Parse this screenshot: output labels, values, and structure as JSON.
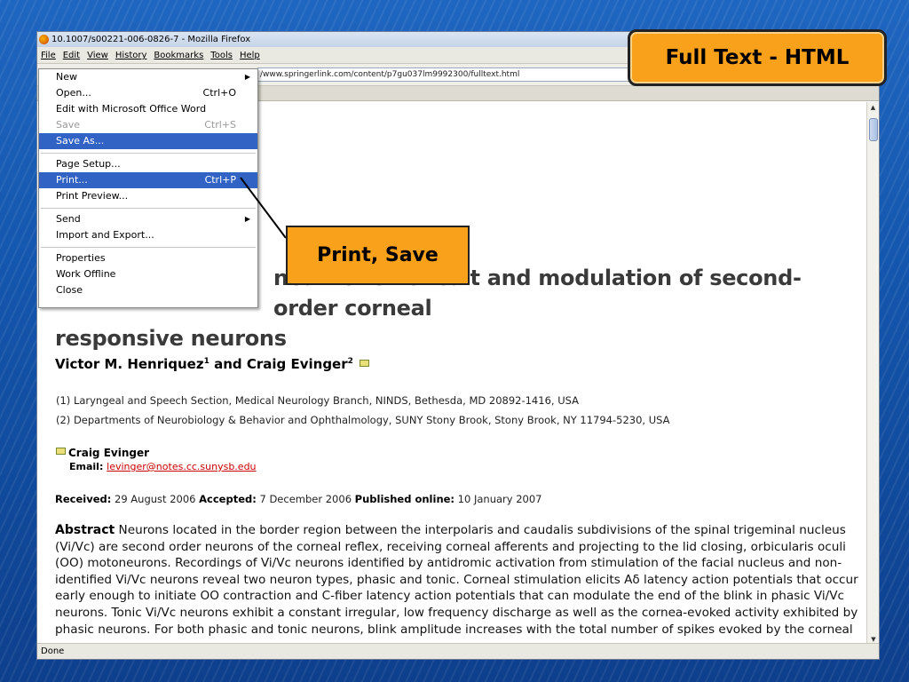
{
  "window": {
    "title": "10.1007/s00221-006-0826-7 - Mozilla Firefox",
    "menu": [
      "File",
      "Edit",
      "View",
      "History",
      "Bookmarks",
      "Tools",
      "Help"
    ],
    "url": "/www.springerlink.com/content/p7gu037lm9992300/fulltext.html",
    "status": "Done"
  },
  "file_menu": {
    "items": [
      {
        "label": "New",
        "shortcut": "",
        "submenu": true
      },
      {
        "label": "Open...",
        "shortcut": "Ctrl+O"
      },
      {
        "label": "Edit with Microsoft Office Word",
        "shortcut": ""
      },
      {
        "label": "Save",
        "shortcut": "Ctrl+S",
        "disabled": true
      },
      {
        "label": "Save As...",
        "shortcut": "",
        "selected": true
      },
      {
        "label": "Page Setup...",
        "shortcut": ""
      },
      {
        "label": "Print...",
        "shortcut": "Ctrl+P",
        "selected": true
      },
      {
        "label": "Print Preview...",
        "shortcut": ""
      },
      {
        "label": "Send",
        "shortcut": "",
        "submenu": true
      },
      {
        "label": "Import and Export...",
        "shortcut": ""
      },
      {
        "label": "Properties",
        "shortcut": ""
      },
      {
        "label": "Work Offline",
        "shortcut": ""
      },
      {
        "label": "Close",
        "shortcut": ""
      }
    ]
  },
  "article": {
    "title_line1": "neal reflex circuit and modulation of second-order corneal",
    "title_line2": "responsive neurons",
    "author1": "Victor M. Henriquez",
    "author1_sup": "1",
    "and": " and ",
    "author2": "Craig Evinger",
    "author2_sup": "2",
    "affiliation1": "(1)  Laryngeal and Speech Section, Medical Neurology Branch, NINDS, Bethesda, MD 20892-1416, USA",
    "affiliation2": "(2)  Departments of Neurobiology & Behavior and Ophthalmology, SUNY Stony Brook, Stony Brook, NY 11794-5230, USA",
    "corr_name": "Craig Evinger",
    "email_label": "Email: ",
    "email": "levinger@notes.cc.sunysb.edu",
    "received_label": "Received:",
    "received": " 29 August 2006  ",
    "accepted_label": "Accepted:",
    "accepted": " 7 December 2006  ",
    "published_label": "Published online:",
    "published": " 10 January 2007",
    "abstract_label": "Abstract",
    "abstract_text": "  Neurons located in the border region between the interpolaris and caudalis subdivisions of the spinal trigeminal nucleus (Vi/Vc) are second order neurons of the corneal reflex, receiving corneal afferents and projecting to the lid closing, orbicularis oculi (OO) motoneurons. Recordings of Vi/Vc neurons identified by antidromic activation from stimulation of the facial nucleus and non-identified Vi/Vc neurons reveal two neuron types, phasic and tonic. Corneal stimulation elicits Aδ latency action potentials that occur early enough to initiate OO contraction and C-fiber latency action potentials that can modulate the end of the blink in phasic Vi/Vc neurons. Tonic Vi/Vc neurons exhibit a constant irregular, low frequency discharge as well as the cornea-evoked activity exhibited by phasic neurons. For both phasic and tonic neurons, blink amplitude increases with the total number of spikes evoked by the corneal stimulus. Peak firing frequency predicts peak orbicularis oculi EMG activity. Paradigms that suppress cornea-evoked blinks differentially"
  },
  "callouts": {
    "top": "Full Text - HTML",
    "mid": "Print, Save"
  },
  "colors": {
    "accent_orange": "#f9a11b",
    "menu_highlight": "#3163c5",
    "background_blue": "#1456ad"
  }
}
